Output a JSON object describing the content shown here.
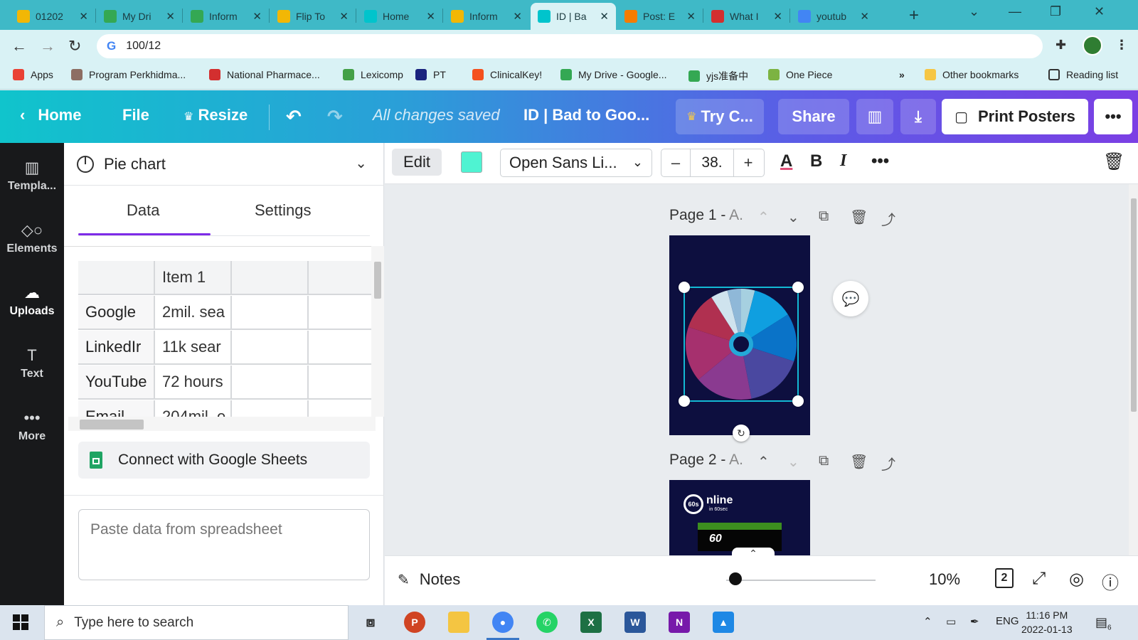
{
  "browser": {
    "tabs": [
      {
        "title": "01202",
        "fav": "#f2b705",
        "icon": "slides-icon"
      },
      {
        "title": "My Dri",
        "fav": "#34a853",
        "icon": "drive-icon"
      },
      {
        "title": "Inform",
        "fav": "#34a853",
        "icon": "drive-icon"
      },
      {
        "title": "Flip To",
        "fav": "#f2b705",
        "icon": "slides-icon"
      },
      {
        "title": "Home",
        "fav": "#00c4cc",
        "icon": "canva-icon"
      },
      {
        "title": "Inform",
        "fav": "#f2b705",
        "icon": "slides-icon"
      },
      {
        "title": "ID | Ba",
        "fav": "#00c4cc",
        "icon": "canva-icon",
        "active": true
      },
      {
        "title": "Post: E",
        "fav": "#f57c00",
        "icon": "blogger-icon"
      },
      {
        "title": "What I",
        "fav": "#d32f2f",
        "icon": "shield-icon"
      },
      {
        "title": "youtub",
        "fav": "#4285f4",
        "icon": "google-icon"
      }
    ],
    "address": "100/12",
    "bookmarks": [
      {
        "label": "Apps",
        "color": "#e94235"
      },
      {
        "label": "Program Perkhidma...",
        "color": "#8d6e63"
      },
      {
        "label": "National Pharmace...",
        "color": "#d32f2f"
      },
      {
        "label": "Lexicomp",
        "color": "#43a047"
      },
      {
        "label": "PT",
        "color": "#1a237e"
      },
      {
        "label": "ClinicalKey!",
        "color": "#f4511e"
      },
      {
        "label": "My Drive - Google...",
        "color": "#34a853"
      },
      {
        "label": "yjs准备中",
        "color": "#34a853"
      },
      {
        "label": "One Piece",
        "color": "#7cb342"
      }
    ],
    "more_bookmarks": "»",
    "other_bookmarks": "Other bookmarks",
    "reading_list": "Reading list"
  },
  "canva": {
    "home": "Home",
    "file": "File",
    "resize": "Resize",
    "saved_status": "All changes saved",
    "doc_title": "ID | Bad to Goo...",
    "try": "Try C...",
    "share": "Share",
    "print": "Print Posters",
    "more": "•••"
  },
  "rail": [
    {
      "label": "Templa...",
      "icon": "template-icon",
      "glyph": "▥"
    },
    {
      "label": "Elements",
      "icon": "elements-icon",
      "glyph": "◇○"
    },
    {
      "label": "Uploads",
      "icon": "upload-cloud-icon",
      "glyph": "☁",
      "active": true
    },
    {
      "label": "Text",
      "icon": "text-icon",
      "glyph": "T"
    },
    {
      "label": "More",
      "icon": "more-dots-icon",
      "glyph": "•••"
    }
  ],
  "panel": {
    "title": "Pie chart",
    "tab_data": "Data",
    "tab_settings": "Settings",
    "grid_header": [
      "",
      "Item 1",
      "",
      ""
    ],
    "grid_rows": [
      [
        "Google",
        "2mil. sea",
        "",
        ""
      ],
      [
        "LinkedIr",
        "11k sear",
        "",
        ""
      ],
      [
        "YouTube",
        "72 hours",
        "",
        ""
      ],
      [
        "Email",
        "204mil. e",
        "",
        ""
      ]
    ],
    "sheets_btn": "Connect with Google Sheets",
    "paste_placeholder": "Paste data from spreadsheet"
  },
  "toolbar": {
    "edit": "Edit",
    "color": "#4ff3d2",
    "font": "Open Sans Li...",
    "minus": "–",
    "size": "38.",
    "plus": "+",
    "more": "•••"
  },
  "canvas": {
    "page1_label": "Page 1 - ",
    "page1_dim": "A.",
    "page2_label": "Page 2 - ",
    "page2_dim": "A.",
    "p2_logo": "60s",
    "p2_title": "nline",
    "p2_sub": "in 60sec",
    "p2_num": "60"
  },
  "pie": {
    "colors": [
      "#a6d0e0",
      "#0f9fe0",
      "#0a73c8",
      "#4a48a0",
      "#8a3a90",
      "#a6306e",
      "#b03050",
      "#cfe3ee",
      "#8fb8d8"
    ]
  },
  "bottom": {
    "notes": "Notes",
    "zoom": "10%",
    "page_count": "2",
    "zoom_level": 0.02
  },
  "taskbar": {
    "search_placeholder": "Type here to search",
    "lang": "ENG",
    "time": "11:16 PM",
    "date": "2022-01-13",
    "notif": "6"
  }
}
